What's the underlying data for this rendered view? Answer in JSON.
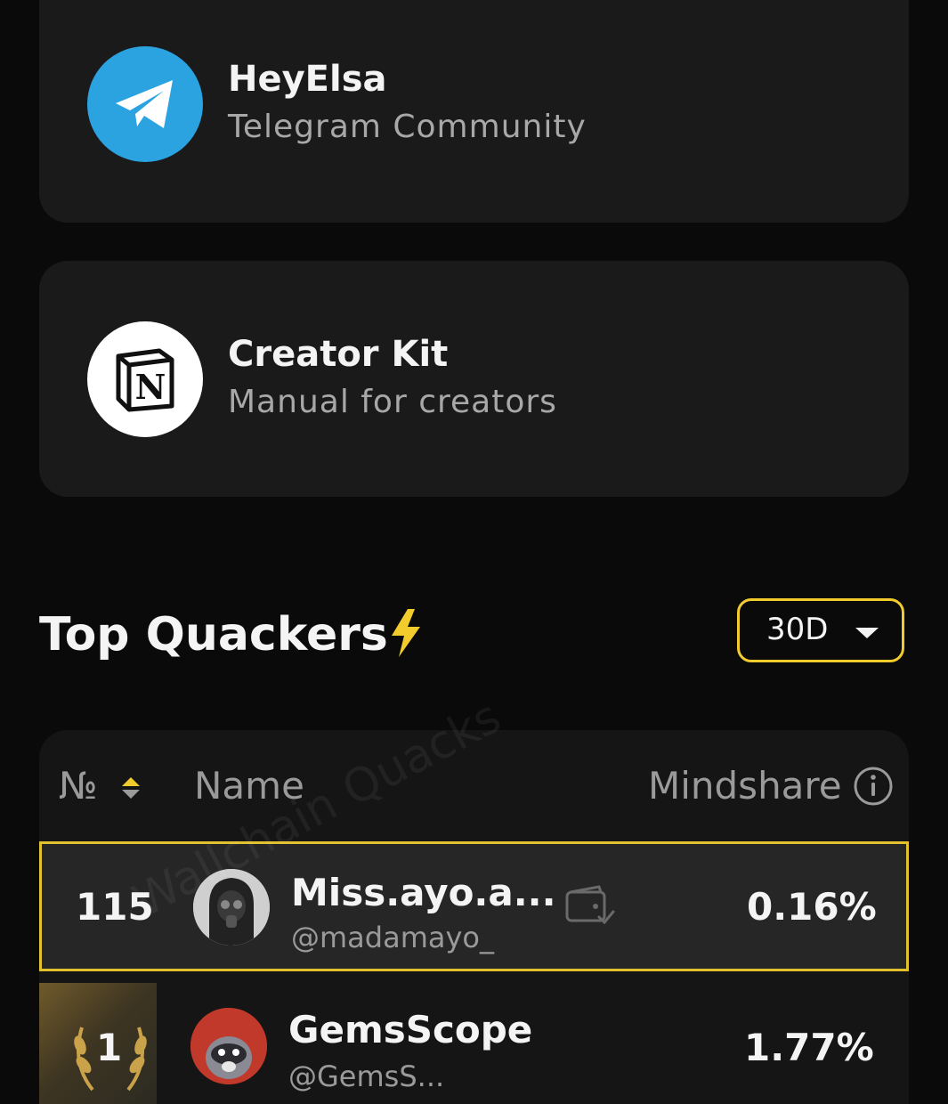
{
  "links": [
    {
      "title": "HeyElsa",
      "subtitle": "Telegram Community",
      "icon": "telegram-icon"
    },
    {
      "title": "Creator Kit",
      "subtitle": "Manual for creators",
      "icon": "notion-icon"
    }
  ],
  "section": {
    "title": "Top Quackers",
    "icon": "lightning-icon",
    "period": "30D"
  },
  "table": {
    "headers": {
      "rank": "№",
      "name": "Name",
      "mindshare": "Mindshare"
    },
    "rows": [
      {
        "rank": "115",
        "name": "Miss.ayo.a...",
        "handle": "@madamayo_",
        "mindshare": "0.16%",
        "wallet_icon": "wallet-check-icon"
      },
      {
        "rank": "1",
        "name": "GemsScope",
        "handle": "@GemsS...",
        "mindshare": "1.77%"
      }
    ]
  },
  "watermark": "Wallchain Quacks",
  "colors": {
    "accent": "#f2cc2c",
    "background": "#0a0a0a",
    "card": "#1a1a1a",
    "telegram": "#2aa3e0"
  }
}
